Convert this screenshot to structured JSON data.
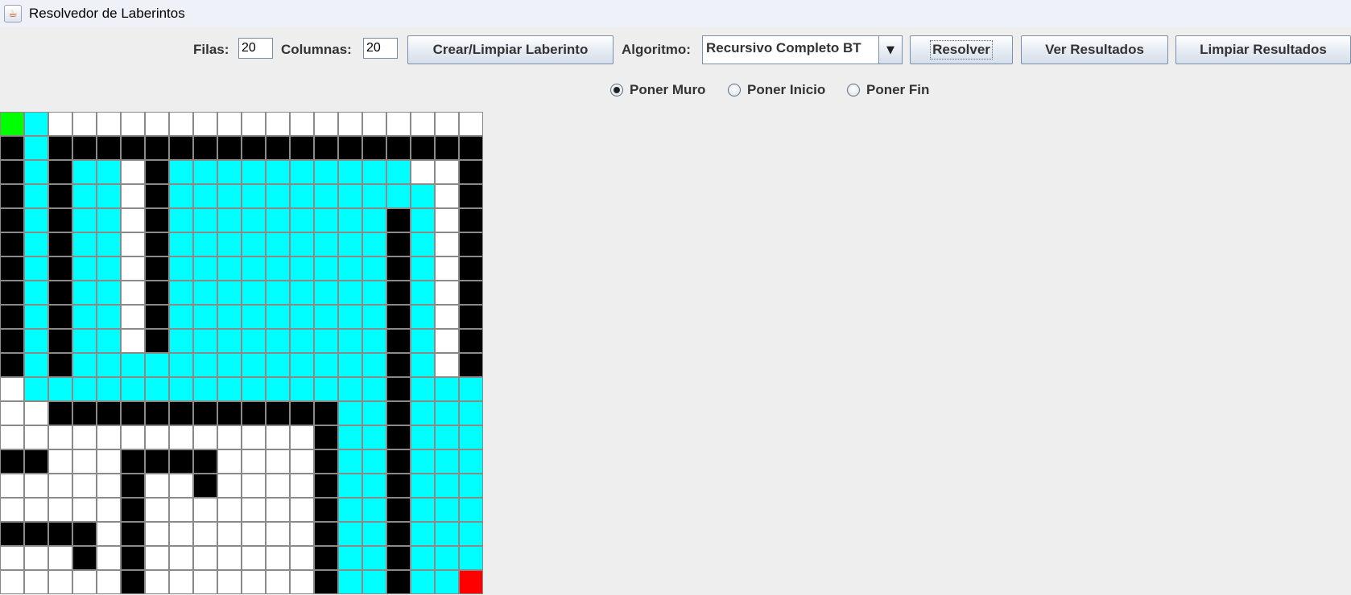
{
  "window": {
    "title": "Resolvedor de Laberintos",
    "icon": "java-cup-icon"
  },
  "toolbar": {
    "rows_label": "Filas:",
    "rows_value": "20",
    "cols_label": "Columnas:",
    "cols_value": "20",
    "create_button": "Crear/Limpiar Laberinto",
    "algorithm_label": "Algoritmo:",
    "algorithm_selected": "Recursivo Completo BT",
    "solve_button": "Resolver",
    "results_button": "Ver Resultados",
    "clear_results_button": "Limpiar Resultados"
  },
  "modes": {
    "wall": "Poner Muro",
    "start": "Poner Inicio",
    "end": "Poner Fin",
    "selected": "wall"
  },
  "maze": {
    "rows": 20,
    "cols": 20,
    "legend": {
      "W": "wall",
      ".": "empty",
      "P": "path",
      "S": "start",
      "E": "end"
    },
    "colors": {
      "wall": "#000000",
      "empty": "#ffffff",
      "path": "#00ffff",
      "start": "#00ff00",
      "end": "#ff0000",
      "grid": "#8a8a8a"
    },
    "grid": [
      "SP..................",
      "WPWWWWWWWWWWWWWWWWWW",
      "WPWPP.WPPPPPPPPPP..W",
      "WPWPP.WPPPPPPPPPPP.W",
      "WPWPP.WPPPPPPPPPWP.W",
      "WPWPP.WPPPPPPPPPWP.W",
      "WPWPP.WPPPPPPPPPWP.W",
      "WPWPP.WPPPPPPPPPWP.W",
      "WPWPP.WPPPPPPPPPWP.W",
      "WPWPP.WPPPPPPPPPWP.W",
      "WPWPPPPPPPPPPPPPWP.W",
      ".PPPPPPPPPPPPPPPWPPP",
      "..WWWWWWWWWWWWPPWPPP",
      ".............WPPWPPP",
      "WW...WWWW....WPPWPPP",
      ".....W..W....WPPWPPP",
      ".....W.......WPPWPPP",
      "WWWW.W.......WPPWPPP",
      "...W.W.......WPPWPPP",
      ".....W.......WPPWPPE"
    ]
  }
}
